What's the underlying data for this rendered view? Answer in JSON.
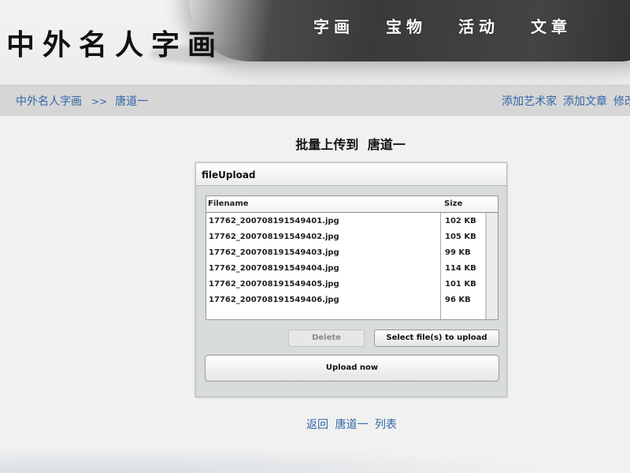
{
  "header": {
    "logo": "中外名人字画",
    "nav": [
      "字画",
      "宝物",
      "活动",
      "文章"
    ]
  },
  "breadcrumb": {
    "home": "中外名人字画",
    "separator": ">>",
    "current": "唐道一"
  },
  "actions": [
    "添加艺术家",
    "添加文章",
    "修改"
  ],
  "title": {
    "prefix": "批量上传到",
    "name": "唐道一"
  },
  "uploader": {
    "title": "fileUpload",
    "columns": {
      "filename": "Filename",
      "size": "Size"
    },
    "files": [
      {
        "name": "17762_200708191549401.jpg",
        "size": "102 KB"
      },
      {
        "name": "17762_200708191549402.jpg",
        "size": "105 KB"
      },
      {
        "name": "17762_200708191549403.jpg",
        "size": "99 KB"
      },
      {
        "name": "17762_200708191549404.jpg",
        "size": "114 KB"
      },
      {
        "name": "17762_200708191549405.jpg",
        "size": "101 KB"
      },
      {
        "name": "17762_200708191549406.jpg",
        "size": "96 KB"
      }
    ],
    "delete_label": "Delete",
    "select_label": "Select file(s) to upload",
    "upload_label": "Upload now"
  },
  "footer": {
    "back": "返回",
    "name": "唐道一",
    "list": "列表"
  },
  "colors": {
    "link": "#3266a8",
    "bar": "#d6d6d6"
  }
}
